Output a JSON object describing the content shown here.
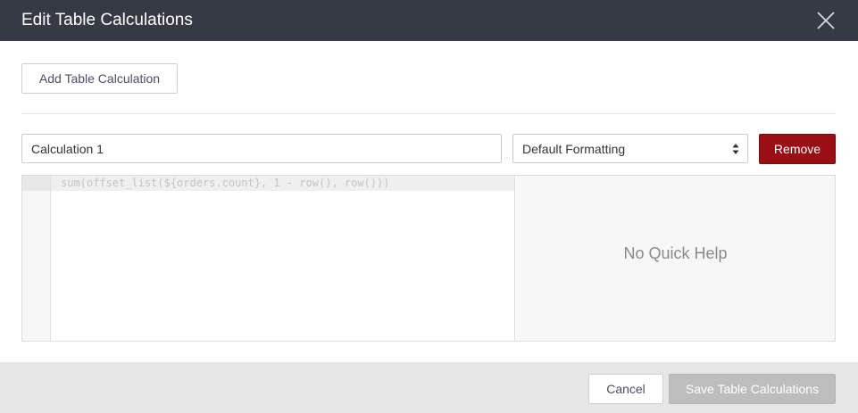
{
  "dialog": {
    "title": "Edit Table Calculations",
    "close_icon": "close-icon"
  },
  "toolbar": {
    "add_label": "Add Table Calculation"
  },
  "calculation": {
    "name_value": "Calculation 1",
    "format_selected": "Default Formatting",
    "format_icon": "select-arrows-icon",
    "remove_label": "Remove",
    "expression": "sum(offset_list(${orders.count}, 1 - row(), row()))"
  },
  "quick_help": {
    "text": "No Quick Help"
  },
  "footer": {
    "cancel_label": "Cancel",
    "save_label": "Save Table Calculations"
  },
  "colors": {
    "header_bg": "#363a45",
    "remove_bg": "#990f14",
    "save_disabled_bg": "#bdbdbd",
    "footer_bg": "#e6e6e6"
  }
}
